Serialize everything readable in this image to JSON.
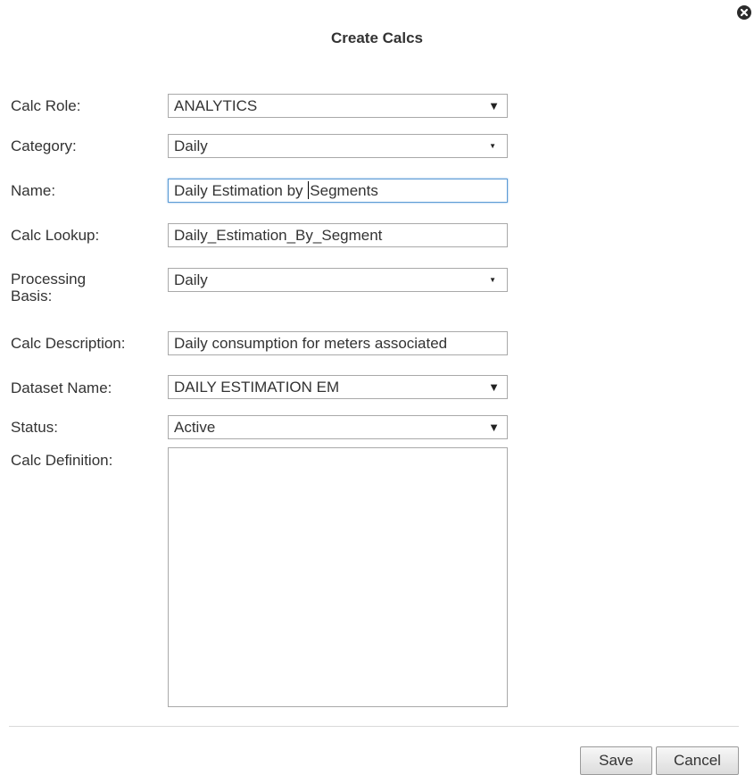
{
  "dialog": {
    "title": "Create Calcs",
    "close_icon": "close-circle-icon"
  },
  "form": {
    "calc_role": {
      "label": "Calc Role:",
      "value": "ANALYTICS"
    },
    "category": {
      "label": "Category:",
      "value": "Daily"
    },
    "name": {
      "label": "Name:",
      "value_before_caret": "Daily Estimation by ",
      "value_after_caret": "Segments"
    },
    "calc_lookup": {
      "label": "Calc Lookup:",
      "value": "Daily_Estimation_By_Segment"
    },
    "processing_basis": {
      "label": "Processing Basis:",
      "value": "Daily"
    },
    "calc_description": {
      "label": "Calc Description:",
      "value": "Daily consumption for meters associated"
    },
    "dataset_name": {
      "label": "Dataset Name:",
      "value": "DAILY ESTIMATION EM"
    },
    "status": {
      "label": "Status:",
      "value": "Active"
    },
    "calc_definition": {
      "label": "Calc Definition:",
      "value": ""
    }
  },
  "buttons": {
    "save": "Save",
    "cancel": "Cancel"
  },
  "icons": {
    "dropdown_arrow": "▼"
  }
}
